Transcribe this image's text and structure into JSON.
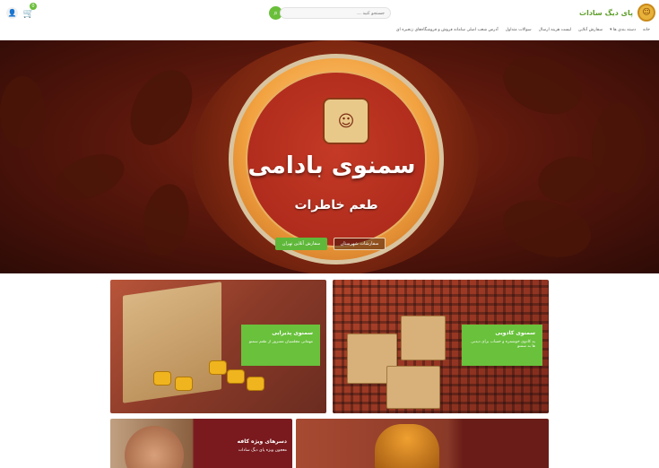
{
  "header": {
    "logo_text": "پای دیگ سادات",
    "search_placeholder": "جستجو کنید ...",
    "search_icon": "search-icon",
    "cart_count": "0",
    "cart_icon": "cart-icon",
    "user_icon": "user-icon"
  },
  "nav": {
    "items": [
      "خانه",
      "دسته بندی ها ▾",
      "سفارش آنلاین",
      "لیست هزینه ارسال",
      "سوالات متداول",
      "آدرس شعب اصلی سامانه فروش و فروشگاه‌های زنجیره ای"
    ]
  },
  "hero": {
    "title": "سمنوی بادامی",
    "subtitle": "طعم خاطرات",
    "btn_tehran": "سفارش آنلاین تهران",
    "btn_city": "سفارشات شهرستان",
    "accent": "#5fb83a"
  },
  "cards": {
    "c1": {
      "title": "سمنوی پذیرایی",
      "subtitle": "مهمانی مجلسیان مسرور از طعم سمنو"
    },
    "c2": {
      "title": "سمنوی کادویی",
      "subtitle": "یه کادوی خوشمزه و حساب برای دیدنی ها به سمنو"
    },
    "c3": {
      "title": "دسرهای ویژه کافه",
      "subtitle": "معجون ویژه پای دیگ سادات"
    }
  },
  "colors": {
    "brand_green": "#69c13c",
    "dark_red": "#7a1a1e"
  }
}
